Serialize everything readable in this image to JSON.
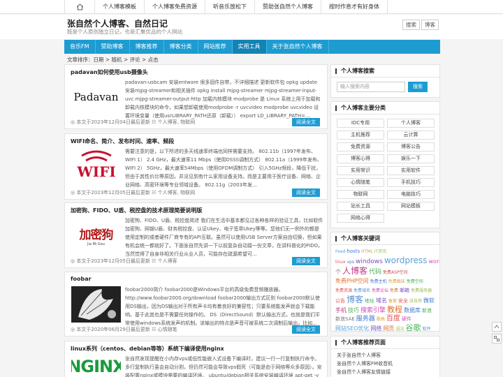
{
  "topnav": [
    "个人博客模板",
    "个人博客免费资源",
    "听音乐放松下",
    "赞助张自然个人博客",
    "按时作息才有好身体"
  ],
  "header": {
    "title": "张自然个人博客、自然日记",
    "subtitle": "既是个人原创独立日记，也是汇聚优品的个人网站",
    "btn_search": "搜索",
    "btn_blog": "博客"
  },
  "menu": [
    "音乐FM",
    "赞助博客",
    "博客推荐",
    "博客分类",
    "网站推荐",
    "实用工具",
    "关于张自然个人博客"
  ],
  "menu_active_index": 5,
  "breadcrumb": "文章排序：日期 > 随机 > 评论 > 点击",
  "articles": [
    {
      "title": "padavan如何使用usb摄像头",
      "summary": "padavan-usbcam 安装entware 很多固件自带，不详细描述 更新软件包 opkg update 安装mjpg-streamer和相关插件 opkg install mjpg-streamer mjpg-streamer-input-uvc mjpg-streamer-output-http 加载内核模块 modprobe 是 Linux 系统上用于加载和卸载内核模块的命令。如果想卸载使用modprobe -r uvcvideo modprobe uvcvideo 设置环境变量（使用usrLIBRARY_PATH还原（卸载）） export LD_LIBRARY_PATH=...",
      "meta": "◎ 本文于2023年12月04日最后更新 ☷ 个人博客, 物联网",
      "thumb_text": "Padavan",
      "more": "阅读全文"
    },
    {
      "title": "WIFI命名、简介、发布时间、速率、频段",
      "summary": "需要注意的是，以下所述的多天线速率终端也同样需要支持。  802.11b（1997年发布、WIFI 1）  2.4 GHz，最大速率11 Mbps（使用DSSS调制方式）  802.11a（1999年发布、WIFI 2）  5GHz，最大速率54Mbps（使用OFDM调制方式）  引入5GHz频段，降低干扰，但由于其性价比等原因，并没见到有什么家用设备支持。而是主要用于医疗设备、网络、企业网络、高密环境等专业领域设备。  802.11g（2003年发...",
      "meta": "◎ 本文于2023年12月05日最后更新 ☷ 个人博客, 物联网",
      "thumb_text": "WIFI",
      "more": "阅读全文"
    },
    {
      "title": "加密狗、FIDO、U盾、税控盘的技术原理简要说明版",
      "summary": "加密狗、FIDO、U盾、税控盘简述 我们在生活中基本都见过各种各样的验证工具，比如软件加密狗、网银U盾、财务税控盘、认证Ukey、电子签章Ukey等等。您他们无一例外的都是使用定制的或者硬件厂商专有的API互联。虽然可以使用USB Server方案自由切换，但如果有机会统一都就好了。下面张自然先讲一下以前复杂自动接一份文章，在讲科普化的PIDO。当然觉得了自身非相关行业从业人员，可能存在疏漏希望可...",
      "meta": "◎ 本文于2023年12月05日最后更新 ☷ 个人博客",
      "thumb_text": "加密狗",
      "thumb_sub": "Jia Mi Gou",
      "more": "阅读全文"
    },
    {
      "title": "foobar",
      "summary": "foobar2000简介 foobar2000是Windows平台的高级免费音频播放器。 http://www.foobar2000.org/download foobar2000输出方式区别 foobar2000默认使用DS输出，因为DS输出对于所有声卡均有着良好的兼容性；只要系统能发声就会下载能响。基于此其也是不需要任何操作的。  DS（DirectSound）默认输出方式，也就是我们平常使用windows系统发声的机制。该输出的特点是声音可被系统二次调制后输出，比如...",
      "meta": "◎ 本文于2020年06月29日最后更新 ☷ 心情随笔",
      "more": "阅读全文"
    },
    {
      "title": "linux系列（centos、debian等等）系统下编译使用nginx",
      "summary": "张自然发现提醒在小内存vps或低性能嵌入式设备下编译时，建议一行一行复制执行命令。多行复制执行虽会自动分割，但仍然可能会导致vps假死（可能是由于网络等众多原因）。安装配置nginx或模块需要的编译环境。 ubuntu/debian相关系统安装编译环境 apt-get -y ins",
      "thumb_text": "NGINX"
    }
  ],
  "sidebar": {
    "search_title": "个人博客搜索",
    "search_placeholder": "输入搜索内容",
    "search_btn": "搜索",
    "cats_title": "个人博客主要分类",
    "cats": [
      "IDC专用",
      "个人博客",
      "主机推荐",
      "云计算",
      "免费资源",
      "博客公告",
      "博客心得",
      "娱乐一下",
      "实用常识",
      "实用软件",
      "心情随笔",
      "手机技巧",
      "物联网",
      "电脑技巧",
      "站长工具",
      "网站模板",
      "网络心得"
    ],
    "tags_title": "个人博客关键词",
    "tags": [
      {
        "t": "Feed",
        "c": "#5aa0d8",
        "s": 6
      },
      {
        "t": "hosts",
        "c": "#3a7bd5",
        "s": 7
      },
      {
        "t": "HTML",
        "c": "#e0a030",
        "s": 6
      },
      {
        "t": "IT资讯",
        "c": "#99bb55",
        "s": 6
      },
      {
        "t": "linux",
        "c": "#e05050",
        "s": 6
      },
      {
        "t": "vps",
        "c": "#3a7bd5",
        "s": 6
      },
      {
        "t": "windows",
        "c": "#7a4fc4",
        "s": 9
      },
      {
        "t": "wordpress",
        "c": "#5aa0d8",
        "s": 12
      },
      {
        "t": "wordpress插件",
        "c": "#d04fb4",
        "s": 8
      },
      {
        "t": "个",
        "c": "#777777",
        "s": 8
      },
      {
        "t": "人博客",
        "c": "#c03a8a",
        "s": 12
      },
      {
        "t": "代码",
        "c": "#45b055",
        "s": 9
      },
      {
        "t": "免费ASP空间",
        "c": "#d05050",
        "s": 6
      },
      {
        "t": "免费PHP空间",
        "c": "#e07030",
        "s": 8
      },
      {
        "t": "免费主机",
        "c": "#3a7bd5",
        "s": 6
      },
      {
        "t": "免费图床",
        "c": "#e0a030",
        "s": 6
      },
      {
        "t": "免费空间",
        "c": "#45b055",
        "s": 6
      },
      {
        "t": "免费资源",
        "c": "#e05050",
        "s": 6
      },
      {
        "t": "免费域名",
        "c": "#5a8fd8",
        "s": 6
      },
      {
        "t": "免费论坛",
        "c": "#d04fb4",
        "s": 6
      },
      {
        "t": "免费",
        "c": "#e07030",
        "s": 6
      },
      {
        "t": "邮箱",
        "c": "#7a4fc4",
        "s": 7
      },
      {
        "t": "免费服务器",
        "c": "#99bb55",
        "s": 6
      },
      {
        "t": "公告",
        "c": "#e05050",
        "s": 7
      },
      {
        "t": "博客",
        "c": "#5a8fd8",
        "s": 12
      },
      {
        "t": "地址",
        "c": "#45b055",
        "s": 7
      },
      {
        "t": "域名",
        "c": "#7a4fc4",
        "s": 8
      },
      {
        "t": "备案",
        "c": "#e0a030",
        "s": 6
      },
      {
        "t": "安全",
        "c": "#e05050",
        "s": 7
      },
      {
        "t": "张自然",
        "c": "#99bb55",
        "s": 6
      },
      {
        "t": "微软",
        "c": "#3a7bd5",
        "s": 8
      },
      {
        "t": "手机",
        "c": "#c03a8a",
        "s": 8
      },
      {
        "t": "技巧",
        "c": "#45b055",
        "s": 8
      },
      {
        "t": "搜索引擎",
        "c": "#d04fb4",
        "s": 9
      },
      {
        "t": "教程",
        "c": "#e07030",
        "s": 11
      },
      {
        "t": "数据库",
        "c": "#3a7bd5",
        "s": 8
      },
      {
        "t": "新浪",
        "c": "#45b055",
        "s": 7
      },
      {
        "t": "新浪SAE",
        "c": "#777777",
        "s": 7
      },
      {
        "t": "服务器",
        "c": "#3a7bd5",
        "s": 9
      },
      {
        "t": "歌曲",
        "c": "#e0a030",
        "s": 6
      },
      {
        "t": "百度",
        "c": "#e05050",
        "s": 10
      },
      {
        "t": "硬件",
        "c": "#d04fb4",
        "s": 7
      },
      {
        "t": "网站SEO优化",
        "c": "#5aa0d8",
        "s": 8
      },
      {
        "t": "网络",
        "c": "#7a4fc4",
        "s": 8
      },
      {
        "t": "网页",
        "c": "#e07030",
        "s": 8
      },
      {
        "t": "语法",
        "c": "#99bb55",
        "s": 6
      },
      {
        "t": "谷歌",
        "c": "#45b055",
        "s": 11
      },
      {
        "t": "软件",
        "c": "#5a8fd8",
        "s": 6
      },
      {
        "t": "邮箱",
        "c": "#c03a8a",
        "s": 7
      }
    ],
    "pages_title": "个人博客推荐页面",
    "pages": [
      "关于张自然个人博客",
      "张自然个人博客FM收音机",
      "张自然个人博客友情链接"
    ]
  }
}
